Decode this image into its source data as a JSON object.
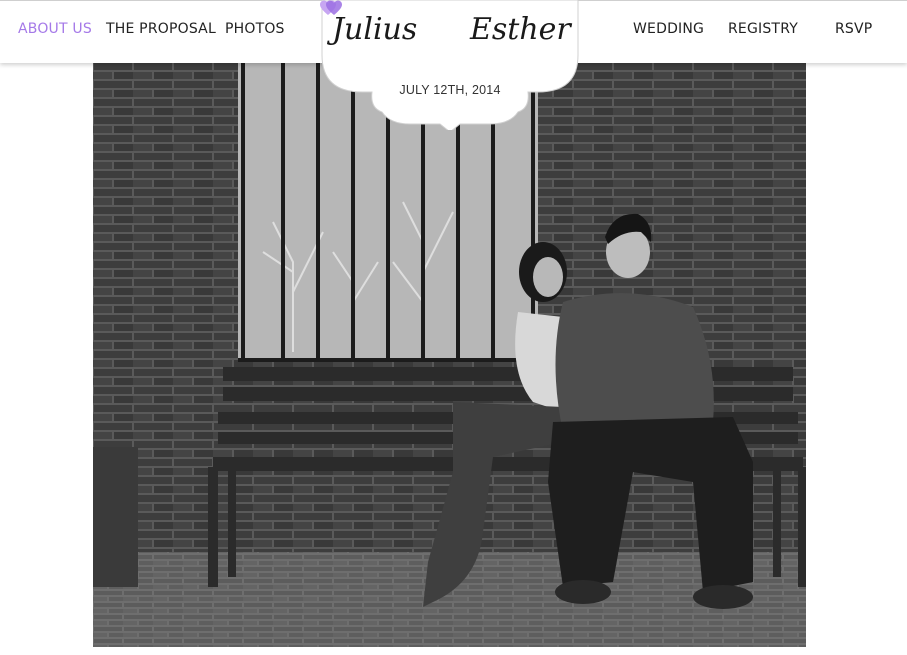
{
  "nav": {
    "left": [
      {
        "label": "ABOUT US",
        "active": true
      },
      {
        "label": "THE PROPOSAL",
        "active": false
      },
      {
        "label": "PHOTOS",
        "active": false
      }
    ],
    "right": [
      {
        "label": "WEDDING",
        "active": false
      },
      {
        "label": "REGISTRY",
        "active": false
      },
      {
        "label": "RSVP",
        "active": false
      }
    ]
  },
  "logo": {
    "name_left": "Julius",
    "name_right": "Esther",
    "heart_icon": "double-heart-icon",
    "date": "JULY 12TH, 2014"
  },
  "hero_photo": {
    "icon": "couple-on-bench-photo"
  },
  "colors": {
    "accent": "#a579e8",
    "nav_text": "#222222",
    "background": "#ffffff"
  }
}
